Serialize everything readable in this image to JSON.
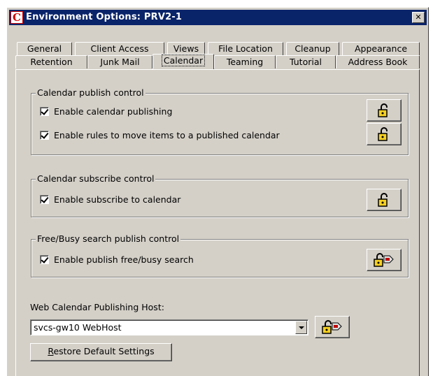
{
  "window": {
    "title": "Environment Options:  PRV2-1",
    "app_icon_letter": "C",
    "close_label": "✕"
  },
  "tabs": {
    "back_row": [
      "General",
      "Client Access",
      "Views",
      "File Location",
      "Cleanup",
      "Appearance"
    ],
    "front_row": [
      "Retention",
      "Junk Mail",
      "Calendar",
      "Teaming",
      "Tutorial",
      "Address Book"
    ],
    "active": "Calendar"
  },
  "publish_group": {
    "title": "Calendar publish control",
    "items": [
      {
        "label": "Enable calendar publishing",
        "checked": true
      },
      {
        "label": "Enable rules to move items to a published calendar",
        "checked": true
      }
    ]
  },
  "subscribe_group": {
    "title": "Calendar subscribe control",
    "items": [
      {
        "label": "Enable subscribe to calendar",
        "checked": true
      }
    ]
  },
  "freebusy_group": {
    "title": "Free/Busy search publish control",
    "items": [
      {
        "label": "Enable publish free/busy search",
        "checked": true
      }
    ]
  },
  "host": {
    "label": "Web Calendar Publishing Host:",
    "value": "svcs-gw10 WebHost"
  },
  "restore_button": {
    "accel": "R",
    "rest": "estore Default Settings"
  },
  "colors": {
    "titlebar": "#0a246a",
    "face": "#d4d0c8",
    "lock": "#f5d020"
  },
  "icons": {
    "lock": "padlock-open-icon",
    "lock_tag": "padlock-with-tag-icon"
  }
}
